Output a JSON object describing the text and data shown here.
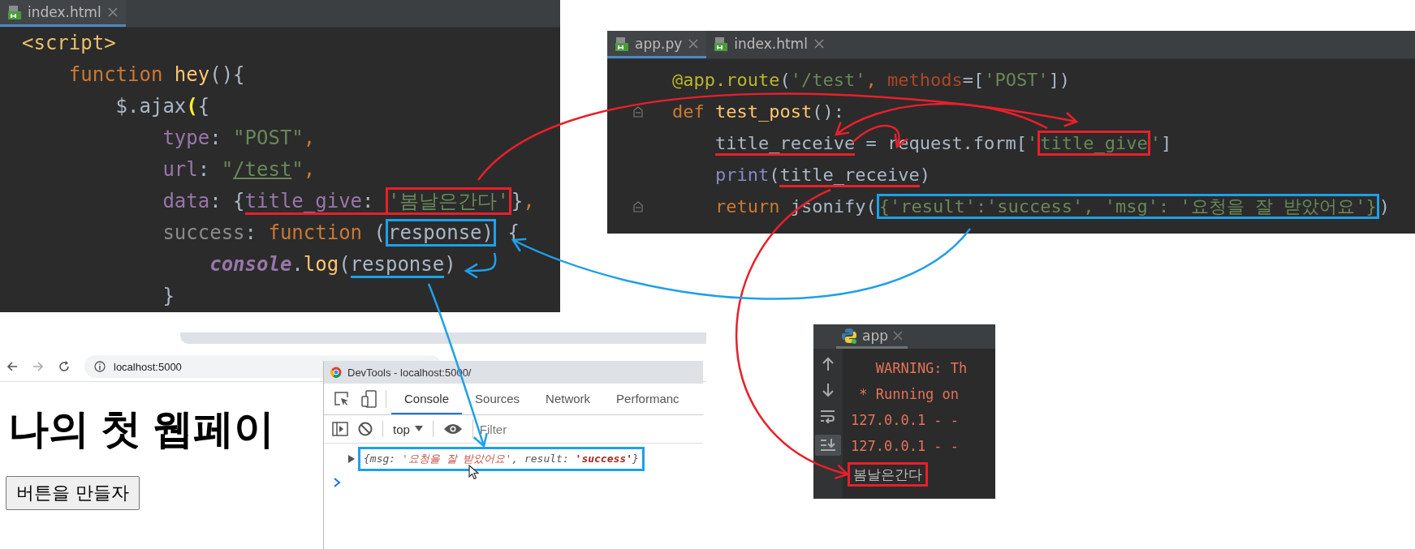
{
  "left_editor": {
    "tabs": [
      {
        "label": "index.html",
        "selected": true
      }
    ],
    "lines": [
      {
        "tokens": [
          {
            "text": "<script>",
            "color": "#e8bf6a",
            "kind": "plain"
          }
        ]
      },
      {
        "tokens": [
          {
            "text": "    function",
            "color": "#cc7832",
            "kind": "plain"
          },
          {
            "text": " hey",
            "color": "#ffc66d",
            "kind": "plain"
          },
          {
            "text": "(){",
            "color": "#a9b7c6",
            "kind": "plain"
          }
        ]
      },
      {
        "tokens": [
          {
            "text": "        $.ajax",
            "color": "#a9b7c6",
            "kind": "plain"
          },
          {
            "text": "(",
            "color": "#ffef28",
            "kind": "match"
          },
          {
            "text": "{",
            "color": "#a9b7c6",
            "kind": "plain"
          }
        ]
      },
      {
        "tokens": [
          {
            "text": "            type",
            "color": "#9876aa",
            "kind": "plain"
          },
          {
            "text": ": ",
            "color": "#a9b7c6",
            "kind": "plain"
          },
          {
            "text": "\"POST\"",
            "color": "#6a8759",
            "kind": "plain"
          },
          {
            "text": ",",
            "color": "#cc7832",
            "kind": "plain"
          }
        ]
      },
      {
        "tokens": [
          {
            "text": "            url",
            "color": "#9876aa",
            "kind": "plain"
          },
          {
            "text": ": ",
            "color": "#a9b7c6",
            "kind": "plain"
          },
          {
            "text": "\"",
            "color": "#6a8759",
            "kind": "plain"
          },
          {
            "text": "/test",
            "color": "#6a8759",
            "kind": "link"
          },
          {
            "text": "\"",
            "color": "#6a8759",
            "kind": "plain"
          },
          {
            "text": ",",
            "color": "#cc7832",
            "kind": "plain"
          }
        ]
      },
      {
        "tokens": [
          {
            "text": "            data",
            "color": "#9876aa",
            "kind": "plain"
          },
          {
            "text": ": {",
            "color": "#a9b7c6",
            "kind": "plain"
          },
          {
            "text": "title_give",
            "color": "#9876aa",
            "kind": "plain",
            "highlights": [
              {
                "kind": "underline",
                "color": "#e8202a"
              }
            ]
          },
          {
            "text": ": ",
            "color": "#a9b7c6",
            "kind": "plain",
            "highlights": [
              {
                "kind": "underline",
                "color": "#e8202a"
              }
            ]
          },
          {
            "text": "'봄날은간다'",
            "color": "#6a8759",
            "kind": "plain",
            "highlights": [
              {
                "kind": "box",
                "color": "#e8202a"
              },
              {
                "kind": "underline",
                "color": "#e8202a"
              }
            ]
          },
          {
            "text": "}",
            "color": "#a9b7c6",
            "kind": "plain"
          },
          {
            "text": ",",
            "color": "#cc7832",
            "kind": "plain"
          }
        ]
      },
      {
        "tokens": [
          {
            "text": "            success",
            "color": "#8a8a8a",
            "kind": "plain"
          },
          {
            "text": ": ",
            "color": "#a9b7c6",
            "kind": "plain"
          },
          {
            "text": "function",
            "color": "#cc7832",
            "kind": "plain"
          },
          {
            "text": " (",
            "color": "#a9b7c6",
            "kind": "plain"
          },
          {
            "text": "response)",
            "color": "#a9b7c6",
            "kind": "plain",
            "highlights": [
              {
                "kind": "box",
                "color": "#1ea0e8"
              }
            ]
          },
          {
            "text": " {",
            "color": "#a9b7c6",
            "kind": "plain"
          }
        ]
      },
      {
        "tokens": [
          {
            "text": "                console",
            "color": "#9876aa",
            "kind": "emphasis"
          },
          {
            "text": ".",
            "color": "#a9b7c6",
            "kind": "plain"
          },
          {
            "text": "log",
            "color": "#ffc66d",
            "kind": "plain"
          },
          {
            "text": "(",
            "color": "#a9b7c6",
            "kind": "plain"
          },
          {
            "text": "response",
            "color": "#a9b7c6",
            "kind": "plain",
            "highlights": [
              {
                "kind": "underline",
                "color": "#1ea0e8"
              }
            ]
          },
          {
            "text": ")",
            "color": "#a9b7c6",
            "kind": "plain"
          }
        ]
      },
      {
        "tokens": [
          {
            "text": "            }",
            "color": "#a9b7c6",
            "kind": "plain"
          }
        ]
      }
    ]
  },
  "right_editor": {
    "tabs": [
      {
        "label": "app.py",
        "selected": true
      },
      {
        "label": "index.html",
        "selected": false
      }
    ],
    "lines": [
      {
        "tokens": [
          {
            "text": "@app.route",
            "color": "#bbb529",
            "kind": "plain"
          },
          {
            "text": "(",
            "color": "#a9b7c6",
            "kind": "plain"
          },
          {
            "text": "'/test'",
            "color": "#6a8759",
            "kind": "plain"
          },
          {
            "text": ", ",
            "color": "#cc7832",
            "kind": "plain"
          },
          {
            "text": "methods",
            "color": "#aa4926",
            "kind": "plain"
          },
          {
            "text": "=[",
            "color": "#a9b7c6",
            "kind": "plain"
          },
          {
            "text": "'POST'",
            "color": "#6a8759",
            "kind": "plain"
          },
          {
            "text": "])",
            "color": "#a9b7c6",
            "kind": "plain"
          }
        ]
      },
      {
        "tokens": [
          {
            "text": "def",
            "color": "#cc7832",
            "kind": "plain"
          },
          {
            "text": " test_post",
            "color": "#ffc66d",
            "kind": "plain"
          },
          {
            "text": "():",
            "color": "#a9b7c6",
            "kind": "plain"
          }
        ]
      },
      {
        "tokens": [
          {
            "text": "    title_receive",
            "color": "#a9b7c6",
            "kind": "plain",
            "highlights": [
              {
                "kind": "underline",
                "color": "#e8202a"
              }
            ]
          },
          {
            "text": " = request.form[",
            "color": "#a9b7c6",
            "kind": "plain"
          },
          {
            "text": "'",
            "color": "#6a8759",
            "kind": "plain"
          },
          {
            "text": "title_give",
            "color": "#6a8759",
            "kind": "plain",
            "highlights": [
              {
                "kind": "box",
                "color": "#e8202a"
              }
            ]
          },
          {
            "text": "'",
            "color": "#6a8759",
            "kind": "plain"
          },
          {
            "text": "]",
            "color": "#a9b7c6",
            "kind": "plain"
          }
        ]
      },
      {
        "tokens": [
          {
            "text": "    print",
            "color": "#8888c6",
            "kind": "plain"
          },
          {
            "text": "(",
            "color": "#a9b7c6",
            "kind": "plain"
          },
          {
            "text": "title_receive",
            "color": "#a9b7c6",
            "kind": "plain",
            "highlights": [
              {
                "kind": "underline",
                "color": "#e8202a"
              }
            ]
          },
          {
            "text": ")",
            "color": "#a9b7c6",
            "kind": "plain"
          }
        ]
      },
      {
        "tokens": [
          {
            "text": "    return",
            "color": "#cc7832",
            "kind": "plain"
          },
          {
            "text": " jsonify(",
            "color": "#a9b7c6",
            "kind": "plain"
          },
          {
            "text": "{'result':'success', 'msg': '요청을 잘 받았어요'}",
            "color": "#6a8759",
            "kind": "plain",
            "highlights": [
              {
                "kind": "box",
                "color": "#1ea0e8"
              }
            ]
          },
          {
            "text": ")",
            "color": "#a9b7c6",
            "kind": "plain"
          }
        ]
      }
    ]
  },
  "browser": {
    "address": "localhost:5000",
    "heading": "나의 첫 웹페이",
    "button": "버튼을 만들자"
  },
  "devtools": {
    "title": "DevTools - localhost:5000/",
    "tabs": [
      {
        "label": "Console",
        "selected": true
      },
      {
        "label": "Sources",
        "selected": false
      },
      {
        "label": "Network",
        "selected": false
      },
      {
        "label": "Performanc",
        "selected": false
      }
    ],
    "context": "top",
    "filter_placeholder": "Filter",
    "log": {
      "highlights": [
        {
          "kind": "box",
          "color": "#1ea0e8"
        }
      ],
      "tokens": [
        {
          "text": "{msg: ",
          "color": "#555555",
          "kind": "plain"
        },
        {
          "text": "'요청을 잘 받았어요'",
          "color": "#c7524a",
          "kind": "plain"
        },
        {
          "text": ", result: ",
          "color": "#555555",
          "kind": "plain"
        },
        {
          "text": "'success'",
          "color": "#a8261c",
          "kind": "strong"
        },
        {
          "text": "}",
          "color": "#555555",
          "kind": "plain"
        }
      ]
    }
  },
  "run_panel": {
    "tab": "app",
    "lines": [
      {
        "text": "   WARNING: Th",
        "color": "#e5735a"
      },
      {
        "text": " * Running on",
        "color": "#e5735a"
      },
      {
        "text": "127.0.0.1 - -",
        "color": "#e5735a"
      },
      {
        "text": "127.0.0.1 - -",
        "color": "#e5735a"
      },
      {
        "text": "봄날은간다",
        "color": "#bbbbbb",
        "highlights": [
          {
            "kind": "box",
            "color": "#e8202a"
          }
        ]
      }
    ]
  },
  "arrows": [
    {
      "color": "#e8202a"
    },
    {
      "color": "#e8202a"
    },
    {
      "color": "#e8202a"
    },
    {
      "color": "#e8202a"
    },
    {
      "color": "#1ea0e8"
    },
    {
      "color": "#1ea0e8"
    },
    {
      "color": "#1ea0e8"
    }
  ]
}
